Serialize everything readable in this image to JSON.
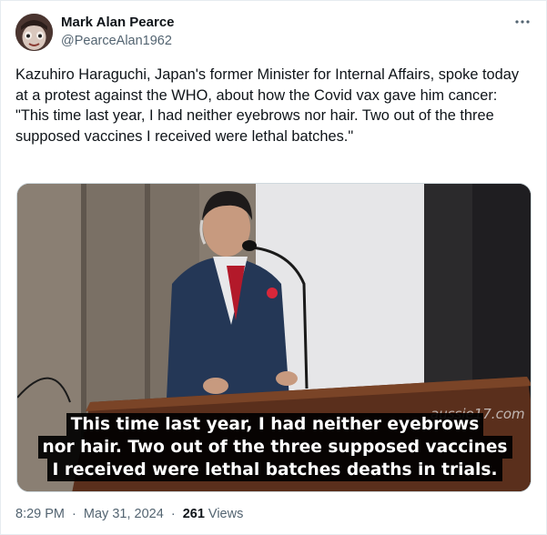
{
  "author": {
    "name": "Mark Alan Pearce",
    "handle": "@PearceAlan1962",
    "avatar_icon": "profile-avatar"
  },
  "more_icon": "more-dots-icon",
  "tweet": {
    "paragraph1": "Kazuhiro Haraguchi, Japan's former Minister for Internal Affairs, spoke today at a protest against the WHO, about how the Covid vax gave him cancer:",
    "paragraph2": "\"This time last year, I had neither eyebrows nor hair. Two out of the three supposed vaccines I received were lethal batches.\""
  },
  "media": {
    "watermark": "aussie17.com",
    "caption": [
      "This time last year, I had neither eyebrows",
      "nor hair. Two out of the three supposed vaccines",
      "I received were lethal batches deaths in trials."
    ]
  },
  "meta": {
    "time": "8:29 PM",
    "separator": "·",
    "date": "May 31, 2024",
    "views_count": "261",
    "views_label": "Views"
  },
  "colors": {
    "text": "#0f1419",
    "secondary": "#536471",
    "border": "#cfd9de"
  }
}
